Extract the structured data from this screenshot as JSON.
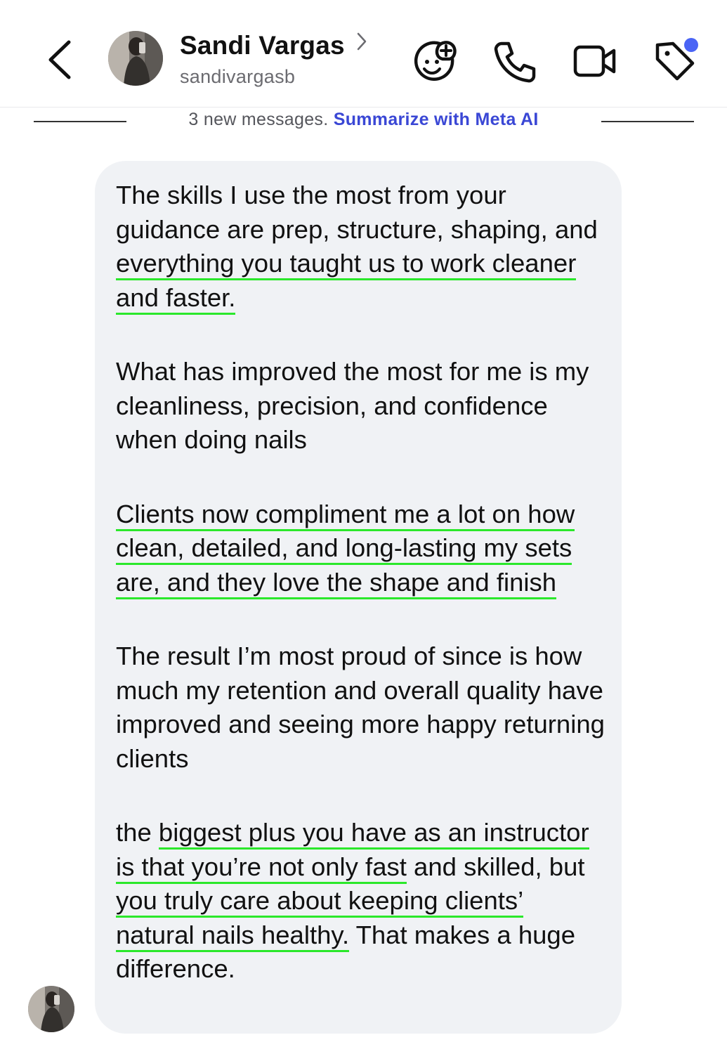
{
  "header": {
    "contact_name": "Sandi Vargas",
    "handle": "sandivargasb",
    "icons": [
      "back-chevron-icon",
      "avatar-photo",
      "chevron-right-icon",
      "sticker-add-icon",
      "phone-icon",
      "video-camera-icon",
      "tag-icon"
    ],
    "tag_notification_color": "#4a64f5"
  },
  "divider": {
    "count_text": "3 new messages.",
    "link_text": "Summarize with Meta AI",
    "link_color": "#3a47d5"
  },
  "message": {
    "bubble_color": "#f0f2f5",
    "highlight_color": "#2be82b",
    "p1": {
      "a": "The skills I use the most from your guidance are prep, structure, shaping, and ",
      "u": "everything you taught us to work cleaner and faster."
    },
    "p2": "What has improved the most for me is my cleanliness, precision, and confidence when doing nails",
    "p3": "Clients now compliment me a lot on how clean, detailed, and long-lasting my sets are, and they love the shape and finish",
    "p4": "The result I’m most proud of since is how much my retention and overall quality have improved and seeing more happy returning clients",
    "p5": {
      "a": "the ",
      "u1": "biggest plus you have as an instructor is that you’re not only fast",
      "b": " and skilled, but ",
      "u2": "you truly care about keeping clients’ natural nails healthy.",
      "c": " That makes a huge difference."
    }
  }
}
